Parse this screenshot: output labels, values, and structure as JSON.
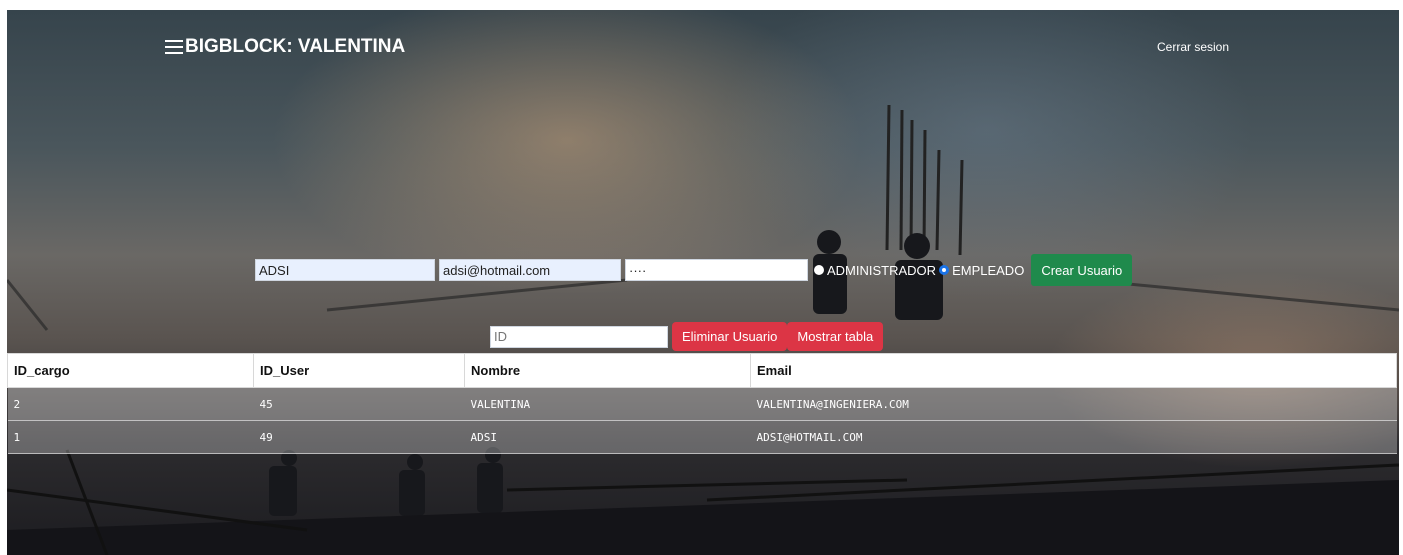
{
  "header": {
    "title": "BIGBLOCK: VALENTINA",
    "logout_label": "Cerrar sesion"
  },
  "create_form": {
    "name_value": "ADSI",
    "email_value": "adsi@hotmail.com",
    "password_value": "····",
    "role_options": [
      {
        "label": "ADMINISTRADOR",
        "checked": false
      },
      {
        "label": "EMPLEADO",
        "checked": true
      }
    ],
    "create_button": "Crear Usuario"
  },
  "delete_form": {
    "id_placeholder": "ID",
    "delete_button": "Eliminar Usuario",
    "show_table_button": "Mostrar tabla"
  },
  "table": {
    "columns": [
      "ID_cargo",
      "ID_User",
      "Nombre",
      "Email"
    ],
    "rows": [
      [
        "2",
        "45",
        "VALENTINA",
        "VALENTINA@INGENIERA.COM"
      ],
      [
        "1",
        "49",
        "ADSI",
        "ADSI@HOTMAIL.COM"
      ]
    ]
  },
  "colors": {
    "create_button": "#1f8a4c",
    "delete_button": "#dc3545",
    "radio_checked": "#1a73e8"
  }
}
